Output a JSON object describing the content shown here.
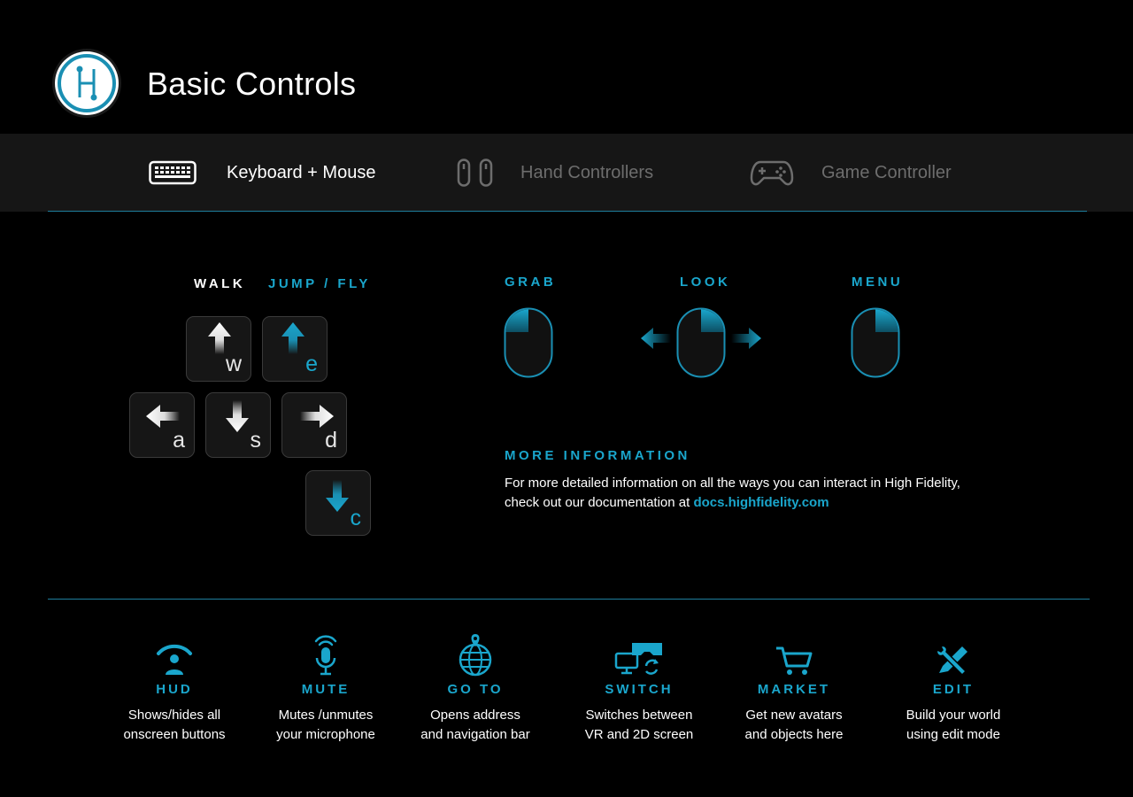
{
  "header": {
    "title": "Basic Controls"
  },
  "tabs": [
    {
      "label": "Keyboard + Mouse",
      "icon": "keyboard-icon",
      "active": true
    },
    {
      "label": "Hand Controllers",
      "icon": "hand-controllers-icon",
      "active": false
    },
    {
      "label": "Game Controller",
      "icon": "gamepad-icon",
      "active": false
    }
  ],
  "keyboard": {
    "walk_label": "WALK",
    "jumpfly_label": "JUMP / FLY",
    "keys": {
      "w": "w",
      "e": "e",
      "a": "a",
      "s": "s",
      "d": "d",
      "c": "c"
    }
  },
  "mouse": {
    "grab_label": "GRAB",
    "look_label": "LOOK",
    "menu_label": "MENU"
  },
  "info": {
    "heading": "MORE INFORMATION",
    "text_line1": "For more detailed information on all the ways you can interact in High Fidelity,",
    "text_line2": "check out our documentation at ",
    "link": "docs.highfidelity.com"
  },
  "features": [
    {
      "name": "HUD",
      "line1": "Shows/hides all",
      "line2": "onscreen buttons",
      "icon": "hud-icon"
    },
    {
      "name": "MUTE",
      "line1": "Mutes /unmutes",
      "line2": "your microphone",
      "icon": "microphone-icon"
    },
    {
      "name": "GO TO",
      "line1": "Opens address",
      "line2": "and navigation bar",
      "icon": "globe-pin-icon"
    },
    {
      "name": "SWITCH",
      "line1": "Switches between",
      "line2": "VR and 2D screen",
      "icon": "vr-switch-icon"
    },
    {
      "name": "MARKET",
      "line1": "Get new avatars",
      "line2": "and objects here",
      "icon": "cart-icon"
    },
    {
      "name": "EDIT",
      "line1": "Build your world",
      "line2": "using edit mode",
      "icon": "edit-tools-icon"
    }
  ],
  "colors": {
    "accent": "#1aa6cc",
    "background": "#000000",
    "tabbar": "#161616"
  }
}
